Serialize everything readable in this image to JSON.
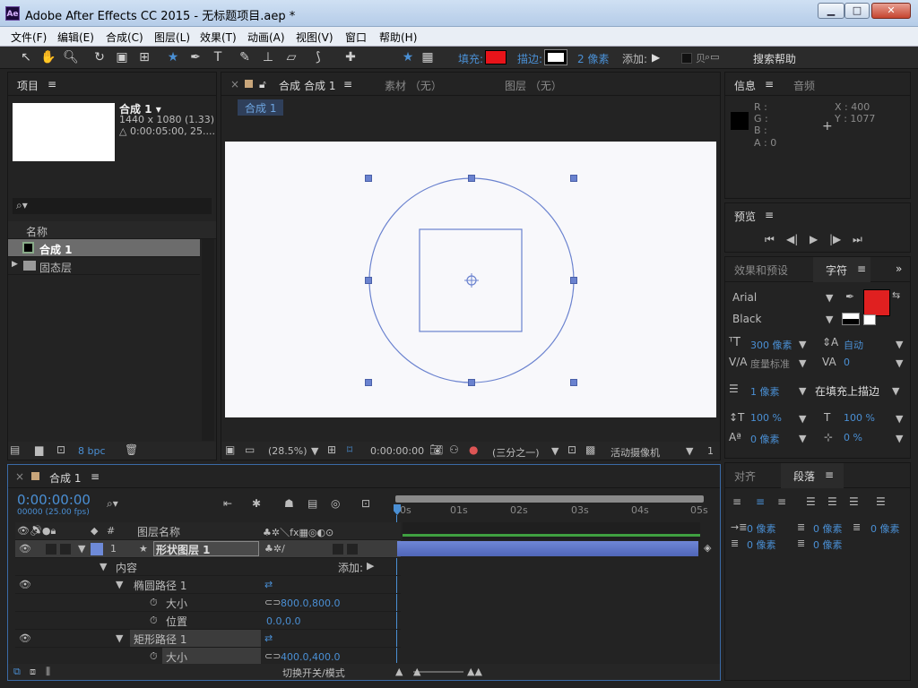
{
  "window": {
    "title": "Adobe After Effects CC 2015 - 无标题项目.aep *",
    "logo": "Ae"
  },
  "menu": [
    "文件(F)",
    "编辑(E)",
    "合成(C)",
    "图层(L)",
    "效果(T)",
    "动画(A)",
    "视图(V)",
    "窗口",
    "帮助(H)"
  ],
  "toolbar": {
    "fill_label": "填充:",
    "stroke_label": "描边:",
    "stroke_width": "2 像素",
    "add_label": "添加:",
    "help_placeholder": "搜索帮助",
    "help_hidden_text": "贝"
  },
  "project": {
    "title": "项目",
    "comp_name": "合成 1 ▾",
    "comp_size": "1440 x 1080 (1.33)",
    "comp_duration": "△ 0:00:05:00, 25....",
    "col_name": "名称",
    "items": [
      {
        "name": "合成 1"
      },
      {
        "name": "固态层"
      }
    ],
    "bpc": "8 bpc"
  },
  "comp_panel": {
    "tab_comp_prefix": "合成",
    "tab_comp_name": "合成 1",
    "tab_footage": "素材 （无）",
    "tab_layer": "图层 （无）",
    "breadcrumb": "合成 1",
    "zoom": "(28.5%)",
    "timecode": "0:00:00:00",
    "resolution": "(三分之一)",
    "camera": "活动摄像机",
    "views": "1"
  },
  "info": {
    "tab_info": "信息",
    "tab_audio": "音频",
    "r": "R :",
    "g": "G :",
    "b": "B :",
    "a": "A : 0",
    "x": "X : 400",
    "y": "Y : 1077"
  },
  "preview": {
    "title": "预览"
  },
  "character": {
    "tab_effects": "效果和预设",
    "tab_char": "字符",
    "font": "Arial",
    "style": "Black",
    "size": "300 像素",
    "leading": "自动",
    "kerning": "度量标准",
    "tracking": "0",
    "stroke": "1 像素",
    "stroke_mode": "在填充上描边",
    "vscale": "100 %",
    "hscale": "100 %",
    "baseline": "0 像素",
    "tsume": "0 %",
    "fill_color": "#e02020"
  },
  "paragraph": {
    "tab_align": "对齐",
    "tab_para": "段落",
    "indent_left": "0 像素",
    "indent_right": "0 像素",
    "indent_first": "0 像素",
    "space_before": "0 像素",
    "space_after": "0 像素"
  },
  "timeline": {
    "tab": "合成 1",
    "timecode": "0:00:00:00",
    "fps": "00000 (25.00 fps)",
    "col_layer_name": "图层名称",
    "rulers": [
      "0s",
      "01s",
      "02s",
      "03s",
      "04s",
      "05s"
    ],
    "layer_num": "1",
    "layer_name": "形状图层 1",
    "contents": "内容",
    "add_label": "添加:",
    "ellipse": "椭圆路径 1",
    "size_label": "大小",
    "ellipse_size": "800.0,800.0",
    "position_label": "位置",
    "ellipse_pos": "0.0,0.0",
    "rect": "矩形路径 1",
    "rect_size": "400.0,400.0",
    "switch_modes": "切换开关/模式"
  }
}
